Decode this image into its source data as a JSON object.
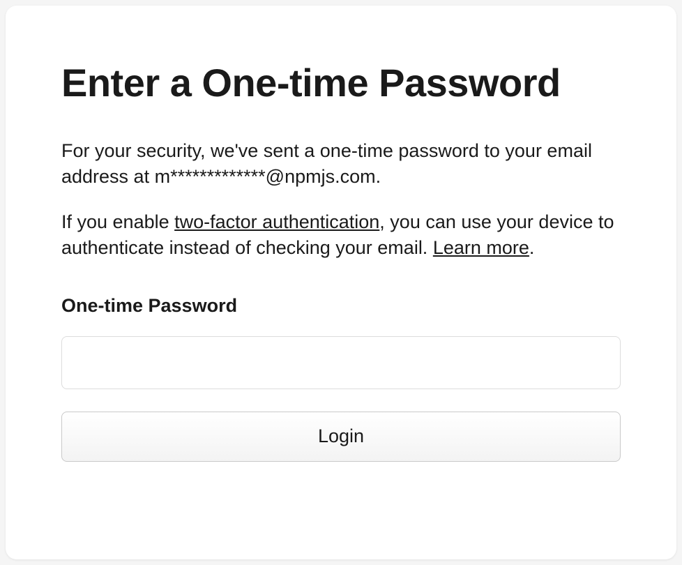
{
  "title": "Enter a One-time Password",
  "description1": {
    "prefix": "For your security, we've sent a one-time password to your email address at ",
    "email": "m*************@npmjs.com",
    "suffix": "."
  },
  "description2": {
    "part1": "If you enable ",
    "link1": "two-factor authentication",
    "part2": ", you can use your device to authenticate instead of checking your email. ",
    "link2": "Learn more",
    "part3": "."
  },
  "form": {
    "label": "One-time Password",
    "value": "",
    "button": "Login"
  }
}
